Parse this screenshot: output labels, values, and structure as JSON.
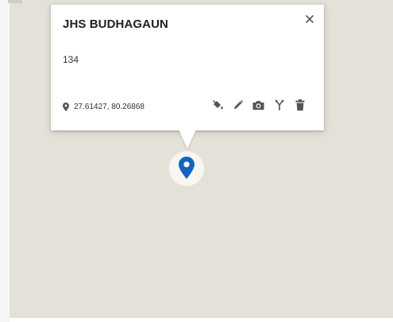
{
  "popup": {
    "title": "JHS BUDHAGAUN",
    "description": "134",
    "coordinates": "27.61427, 80.26868"
  },
  "icons": {
    "close": "close-icon",
    "location": "location-pin-icon",
    "style": "paint-bucket-icon",
    "edit": "pencil-icon",
    "photo": "camera-icon",
    "directions": "directions-icon",
    "delete": "trash-icon",
    "marker": "map-marker-icon"
  },
  "colors": {
    "map_background": "#e4e1d8",
    "marker": "#1565c0",
    "icon": "#555555"
  }
}
